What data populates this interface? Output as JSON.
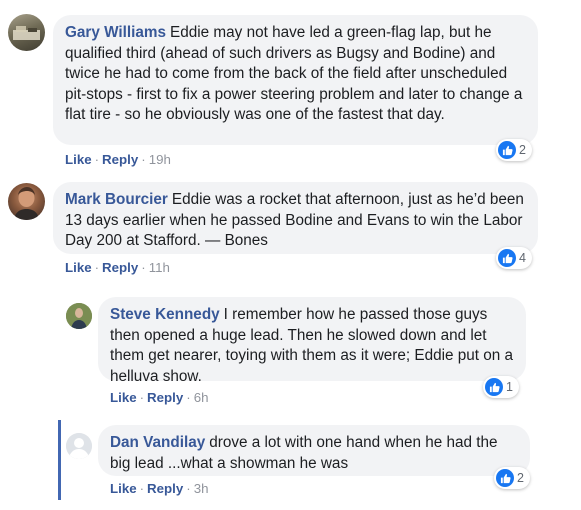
{
  "comments": [
    {
      "author": "Gary Williams",
      "text": "Eddie may not have led a green-flag lap, but he qualified third (ahead of such drivers as Bugsy and Bodine) and twice he had to come from the back of the field after unscheduled pit-stops - first to fix a power steering problem and later to change a flat tire - so he obviously was one of the fastest that day.",
      "like_label": "Like",
      "reply_label": "Reply",
      "time": "19h",
      "reaction_count": "2"
    },
    {
      "author": "Mark Bourcier",
      "text": "Eddie was a rocket that afternoon, just as he’d been 13 days earlier when he passed Bodine and Evans to win the Labor Day 200 at Stafford. — Bones",
      "like_label": "Like",
      "reply_label": "Reply",
      "time": "11h",
      "reaction_count": "4"
    },
    {
      "author": "Steve Kennedy",
      "text": "I remember how he passed those guys then opened a huge lead. Then he slowed down and let them get nearer, toying with them as it were; Eddie put on a helluva show.",
      "like_label": "Like",
      "reply_label": "Reply",
      "time": "6h",
      "reaction_count": "1"
    },
    {
      "author": "Dan Vandilay",
      "text": "drove a lot with one hand when he had the big lead ...what a showman he was",
      "like_label": "Like",
      "reply_label": "Reply",
      "time": "3h",
      "reaction_count": "2"
    }
  ],
  "separator": "·",
  "colors": {
    "link": "#385898",
    "bubble": "#f2f3f5",
    "like_blue": "#1877f2",
    "reply_bar": "#4267b2",
    "meta": "#90949c"
  },
  "icons": [
    "avatar-photo",
    "like-thumbs-up-icon"
  ]
}
